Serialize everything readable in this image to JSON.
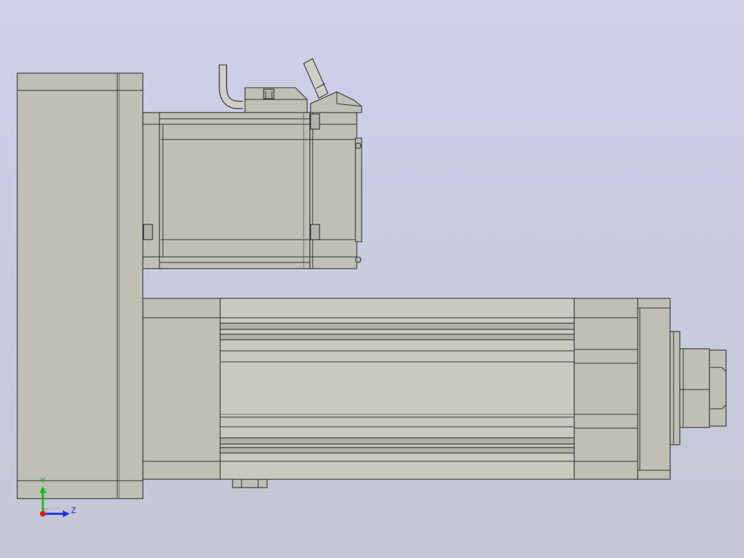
{
  "viewport": {
    "background_top": "#cfd0e8",
    "background_bottom": "#c4c6d4",
    "model_color": "#bfbfb5",
    "edge_color": "#2c2c2c"
  },
  "triad": {
    "y_label": "Y",
    "z_label": "Z",
    "y_color": "#1db81d",
    "z_color": "#1a2fd6",
    "x_color": "#d81a1a"
  }
}
